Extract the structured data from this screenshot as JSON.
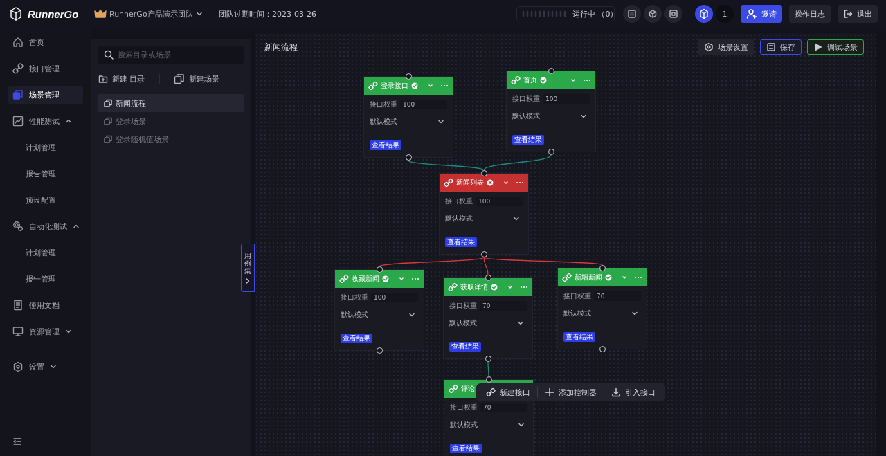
{
  "header": {
    "logo_text": "RunnerGo",
    "team_name": "RunnerGo产品演示团队",
    "expiry": "团队过期时间：2023-03-26",
    "run_status": "运行中 （0）",
    "user_count": "1",
    "invite_button": "邀请",
    "log_button": "操作日志",
    "logout_button": "退出"
  },
  "sidebar": {
    "items": [
      {
        "label": "首页",
        "selected": false
      },
      {
        "label": "接口管理",
        "selected": false
      },
      {
        "label": "场景管理",
        "selected": true
      },
      {
        "label": "性能测试",
        "selected": false,
        "expanded": true,
        "children": [
          {
            "label": "计划管理",
            "selected": false
          },
          {
            "label": "报告管理",
            "selected": false
          },
          {
            "label": "预设配置",
            "selected": false
          }
        ]
      },
      {
        "label": "自动化测试",
        "selected": false,
        "expanded": true,
        "children": [
          {
            "label": "计划管理",
            "selected": false
          },
          {
            "label": "报告管理",
            "selected": false
          }
        ]
      },
      {
        "label": "使用文档",
        "selected": false
      },
      {
        "label": "资源管理",
        "selected": false,
        "expanded": false
      }
    ],
    "settings": {
      "label": "设置",
      "expanded": false
    }
  },
  "scene_panel": {
    "search": {
      "placeholder": "搜索目录或场景"
    },
    "new_folder": "新建 目录",
    "new_scene": "新建场景",
    "scenes": [
      {
        "label": "新闻流程",
        "selected": true
      },
      {
        "label": "登录场景",
        "selected": false
      },
      {
        "label": "登录随机值场景",
        "selected": false
      }
    ]
  },
  "case_tab": "用例集",
  "canvas": {
    "title": "新闻流程",
    "buttons": [
      {
        "label": "场景设置",
        "kind": "settings"
      },
      {
        "label": "保存",
        "kind": "save"
      },
      {
        "label": "调试场景",
        "kind": "run"
      }
    ],
    "nodes": [
      {
        "title": "登录接口",
        "passed": true,
        "covered": false,
        "weight_label": "接口权重",
        "weight": "100",
        "mode": "默认模式",
        "result_button": "查看结果"
      },
      {
        "title": "首页",
        "passed": true,
        "covered": false,
        "weight_label": "接口权重",
        "weight": "100",
        "mode": "默认模式",
        "result_button": "查看结果"
      },
      {
        "title": "新闻列表",
        "passed": false,
        "covered": false,
        "weight_label": "接口权重",
        "weight": "100",
        "mode": "默认模式",
        "result_button": "查看结果"
      },
      {
        "title": "收藏新闻",
        "passed": true,
        "covered": false,
        "weight_label": "接口权重",
        "weight": "100",
        "mode": "默认模式",
        "result_button": "查看结果"
      },
      {
        "title": "获取详情",
        "passed": true,
        "covered": false,
        "weight_label": "接口权重",
        "weight": "70",
        "mode": "默认模式",
        "result_button": "查看结果"
      },
      {
        "title": "新增新闻",
        "passed": true,
        "covered": false,
        "weight_label": "接口权重",
        "weight": "70",
        "mode": "默认模式",
        "result_button": "查看结果"
      },
      {
        "title": "评论",
        "passed": true,
        "covered": true,
        "weight_label": "接口权重",
        "weight": "70",
        "mode": "默认模式",
        "result_button": "查看结果"
      }
    ],
    "toolbar": [
      {
        "label": "新建接口"
      },
      {
        "label": "添加控制器"
      },
      {
        "label": "引入接口"
      }
    ]
  }
}
